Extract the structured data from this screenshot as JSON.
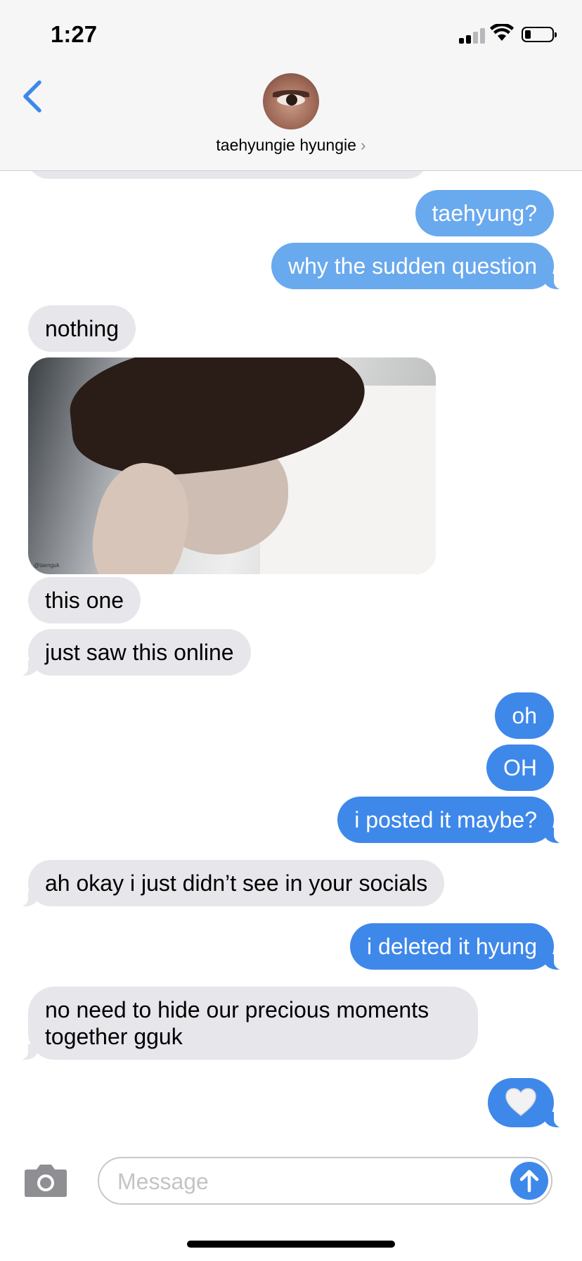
{
  "status_bar": {
    "time": "1:27",
    "signal_icon": "signal-bars-icon",
    "wifi_icon": "wifi-icon",
    "battery_icon": "battery-low-icon",
    "battery_fraction": 0.15
  },
  "header": {
    "back_icon": "chevron-left-icon",
    "contact_name": "taehyungie hyungie",
    "chevron": "›",
    "avatar": "contact-avatar"
  },
  "messages": [
    {
      "from": "me",
      "text": "taehyung?"
    },
    {
      "from": "me",
      "text": "why the sudden question"
    },
    {
      "from": "them",
      "text": "nothing"
    },
    {
      "from": "them",
      "type": "image",
      "watermark": "@taenguk"
    },
    {
      "from": "them",
      "text": "this one"
    },
    {
      "from": "them",
      "text": "just saw this online"
    },
    {
      "from": "me",
      "text": "oh"
    },
    {
      "from": "me",
      "text": "OH"
    },
    {
      "from": "me",
      "text": "i posted it maybe?"
    },
    {
      "from": "them",
      "text": "ah okay i just didn’t see in your socials"
    },
    {
      "from": "me",
      "text": "i deleted it hyung"
    },
    {
      "from": "them",
      "text": "no need to hide our precious moments together gguk"
    },
    {
      "from": "me",
      "type": "emoji",
      "icon": "white-heart-icon"
    }
  ],
  "composer": {
    "camera_icon": "camera-icon",
    "placeholder": "Message",
    "value": "",
    "send_icon": "arrow-up-icon"
  },
  "colors": {
    "outgoing_light": "#69a9ee",
    "outgoing": "#3e88ea",
    "incoming": "#e6e6eb",
    "accent": "#3e88ea"
  }
}
